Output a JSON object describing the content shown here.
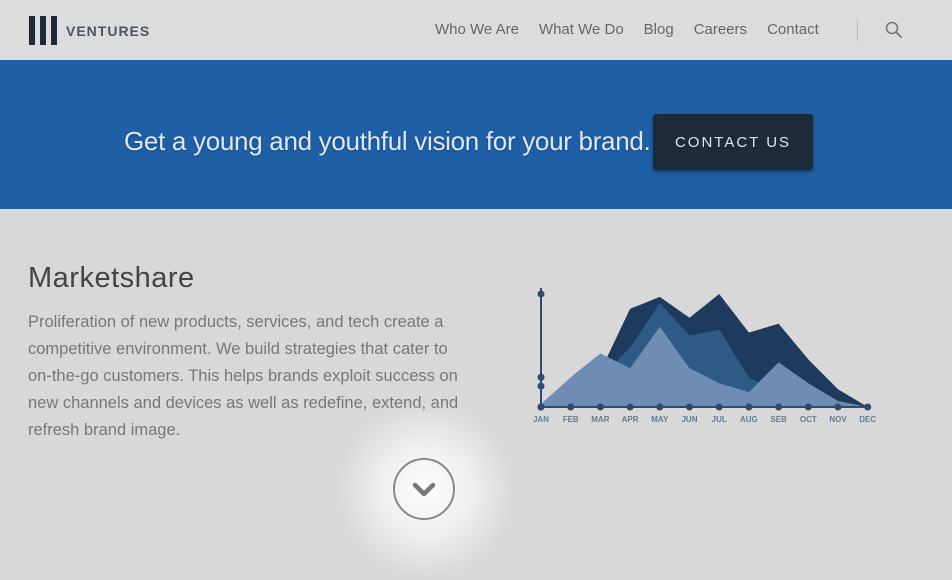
{
  "header": {
    "logo_text": "VENTURES",
    "nav": [
      "Who We Are",
      "What We Do",
      "Blog",
      "Careers",
      "Contact"
    ],
    "search_icon": "search-icon"
  },
  "banner": {
    "tagline": "Get a young and youthful vision for your brand.",
    "cta_label": "CONTACT US",
    "background": "#1f5fa6",
    "button_color": "#1c2a3a"
  },
  "content": {
    "title": "Marketshare",
    "body": "Proliferation of new products, services, and tech create a competitive environment. We build strategies that cater to on-the-go customers. This helps brands exploit success on new channels and devices as well as redefine, extend, and refresh brand image."
  },
  "chart_data": {
    "type": "area",
    "categories": [
      "JAN",
      "FEB",
      "MAR",
      "APR",
      "MAY",
      "JUN",
      "JUL",
      "AUG",
      "SEB",
      "OCT",
      "NOV",
      "DEC"
    ],
    "series": [
      {
        "values": [
          0,
          0,
          1.2,
          3.3,
          3.7,
          3.0,
          3.8,
          2.5,
          2.8,
          1.6,
          0.6,
          0
        ],
        "color": "#1e3a5c"
      },
      {
        "values": [
          0,
          0,
          1.0,
          2.0,
          3.5,
          2.4,
          2.6,
          1.0,
          0.5,
          0.4,
          0.2,
          0
        ],
        "color": "#2e5a86"
      },
      {
        "values": [
          0.1,
          1.0,
          1.8,
          1.3,
          2.7,
          1.3,
          0.8,
          0.5,
          1.5,
          0.8,
          0.2,
          0
        ],
        "color": "#6f8db4"
      }
    ],
    "ylim": [
      0,
      4
    ],
    "y_ticks": [
      0,
      0.7,
      1.0,
      3.8
    ],
    "axis_color": "#2e4a6e"
  },
  "scroll": {
    "icon": "chevron-down-icon"
  }
}
